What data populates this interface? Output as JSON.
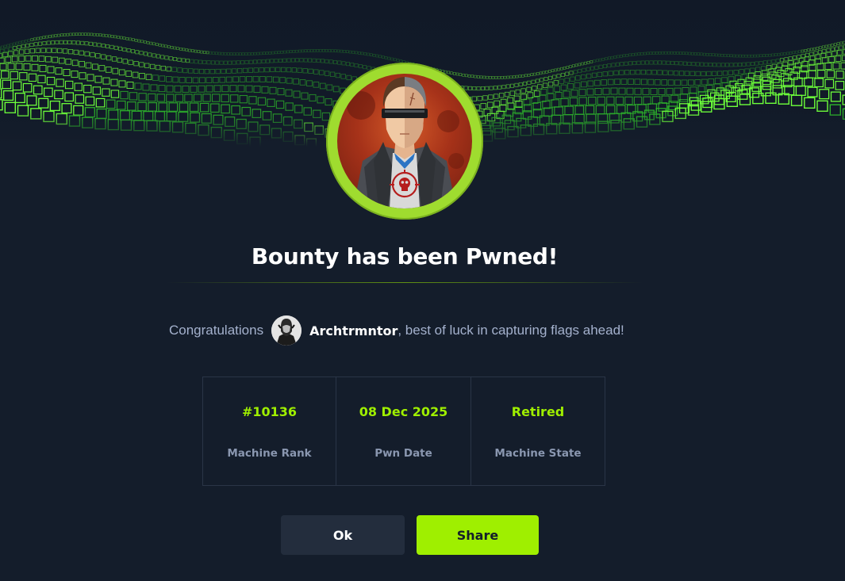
{
  "banner": {
    "decor": "green-cube-wave"
  },
  "avatar": {
    "icon": "machine-avatar-icon"
  },
  "title": "Bounty has been Pwned!",
  "congrats": {
    "prefix": "Congratulations",
    "username": "Archtrmntor",
    "suffix": ", best of luck in capturing flags ahead!"
  },
  "stats": [
    {
      "value": "#10136",
      "label": "Machine Rank"
    },
    {
      "value": "08 Dec 2025",
      "label": "Pwn Date"
    },
    {
      "value": "Retired",
      "label": "Machine State"
    }
  ],
  "buttons": {
    "ok": "Ok",
    "share": "Share"
  },
  "colors": {
    "background": "#141d2b",
    "accent": "#9fef00",
    "muted_text": "#a4b1cd"
  }
}
